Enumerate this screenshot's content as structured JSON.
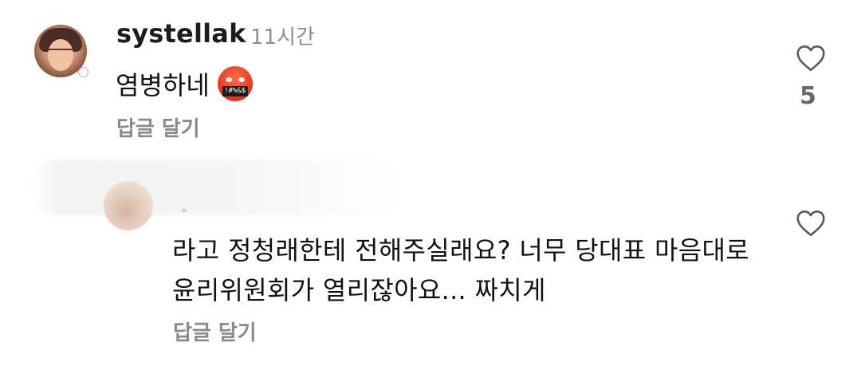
{
  "comments": [
    {
      "username": "systellak",
      "time": "11시간",
      "text": "염병하네",
      "emoji": "face-with-symbols-on-mouth-icon",
      "emoji_text": "!#%&$",
      "reply_label": "답글 달기",
      "like_count": "5"
    },
    {
      "username": "",
      "line1": "라고 정청래한테 전해주실래요? 너무 당대표 마음대로",
      "line2": "윤리위원회가 열리잖아요... 짜치게",
      "reply_label": "답글 달기"
    }
  ],
  "colors": {
    "muted_text": "#8e8e8e",
    "heart_stroke": "#5a5a5a"
  }
}
